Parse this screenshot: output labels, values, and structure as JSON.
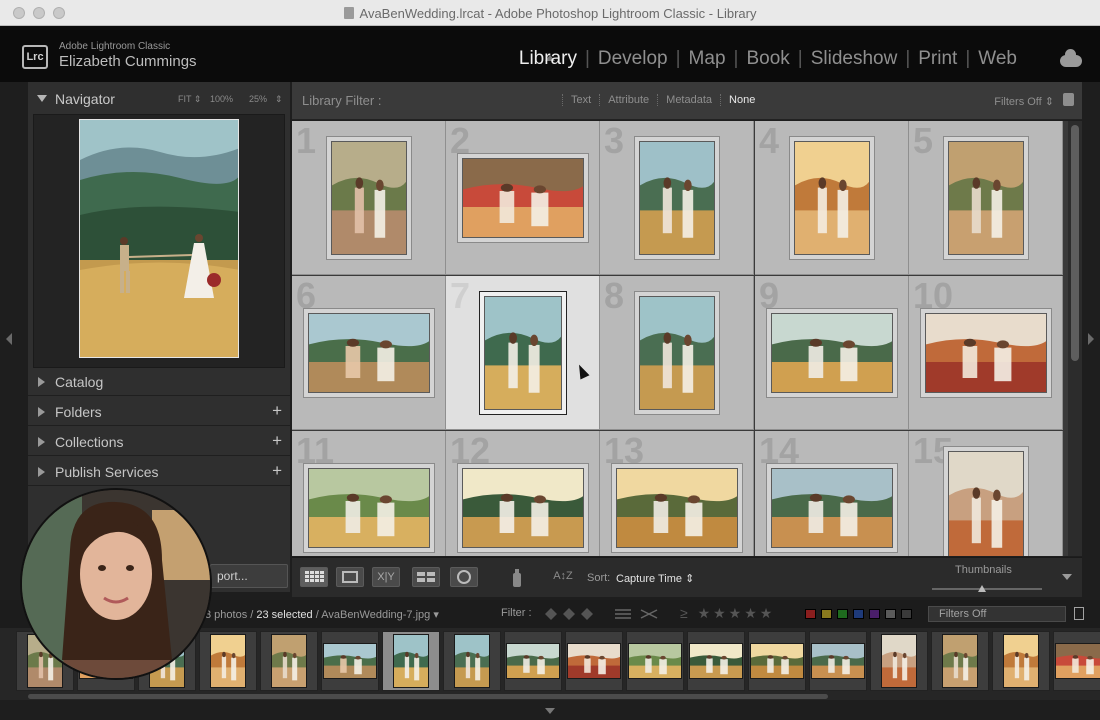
{
  "window": {
    "title": "AvaBenWedding.lrcat - Adobe Photoshop Lightroom Classic - Library"
  },
  "identity": {
    "app_name": "Adobe Lightroom Classic",
    "user_name": "Elizabeth Cummings",
    "logo_text": "Lrc"
  },
  "modules": [
    "Library",
    "Develop",
    "Map",
    "Book",
    "Slideshow",
    "Print",
    "Web"
  ],
  "active_module": "Library",
  "navigator": {
    "title": "Navigator",
    "zoom_fit": "FIT ⇕",
    "zoom_100": "100%",
    "zoom_25": "25%",
    "zoom_more": "⇕"
  },
  "left_panels": [
    {
      "label": "Catalog",
      "has_plus": false
    },
    {
      "label": "Folders",
      "has_plus": true
    },
    {
      "label": "Collections",
      "has_plus": true
    },
    {
      "label": "Publish Services",
      "has_plus": true
    }
  ],
  "export_button": "port...",
  "library_filter": {
    "title": "Library Filter :",
    "options": [
      "Text",
      "Attribute",
      "Metadata",
      "None"
    ],
    "active": "None",
    "filters_off": "Filters Off ⇕"
  },
  "grid": {
    "cells": [
      {
        "num": "1"
      },
      {
        "num": "2"
      },
      {
        "num": "3"
      },
      {
        "num": "4"
      },
      {
        "num": "5"
      },
      {
        "num": "6"
      },
      {
        "num": "7"
      },
      {
        "num": "8"
      },
      {
        "num": "9"
      },
      {
        "num": "10"
      },
      {
        "num": "11"
      },
      {
        "num": "12"
      },
      {
        "num": "13"
      },
      {
        "num": "14"
      },
      {
        "num": "15"
      }
    ],
    "selected": "7"
  },
  "toolbar": {
    "sort_label": "Sort:",
    "sort_value": "Capture Time ⇕",
    "thumbnails_label": "Thumbnails",
    "thumbnail_size": 0.45
  },
  "filmstrip": {
    "count_text": "3 photos /",
    "selected_text": "23 selected",
    "filename": "/ AvaBenWedding-7.jpg ▾",
    "filter_label": "Filter :",
    "stars_prefix": "≥",
    "stars": "★★★★★",
    "filters_off": "Filters Off",
    "color_labels": [
      "#8a1e1e",
      "#8a7a1e",
      "#1e6a1e",
      "#1e3a7a",
      "#4a1e6a",
      "#5a5a5a",
      "#3a3a3a"
    ],
    "selected_index": 6
  },
  "icons": {
    "cloud": "cloud-icon",
    "lock": "lock-icon",
    "grid_view": "grid-view-icon",
    "loupe_view": "loupe-view-icon",
    "compare_view": "compare-view-icon",
    "survey_view": "survey-view-icon",
    "people_view": "people-view-icon",
    "spray": "painter-icon"
  }
}
